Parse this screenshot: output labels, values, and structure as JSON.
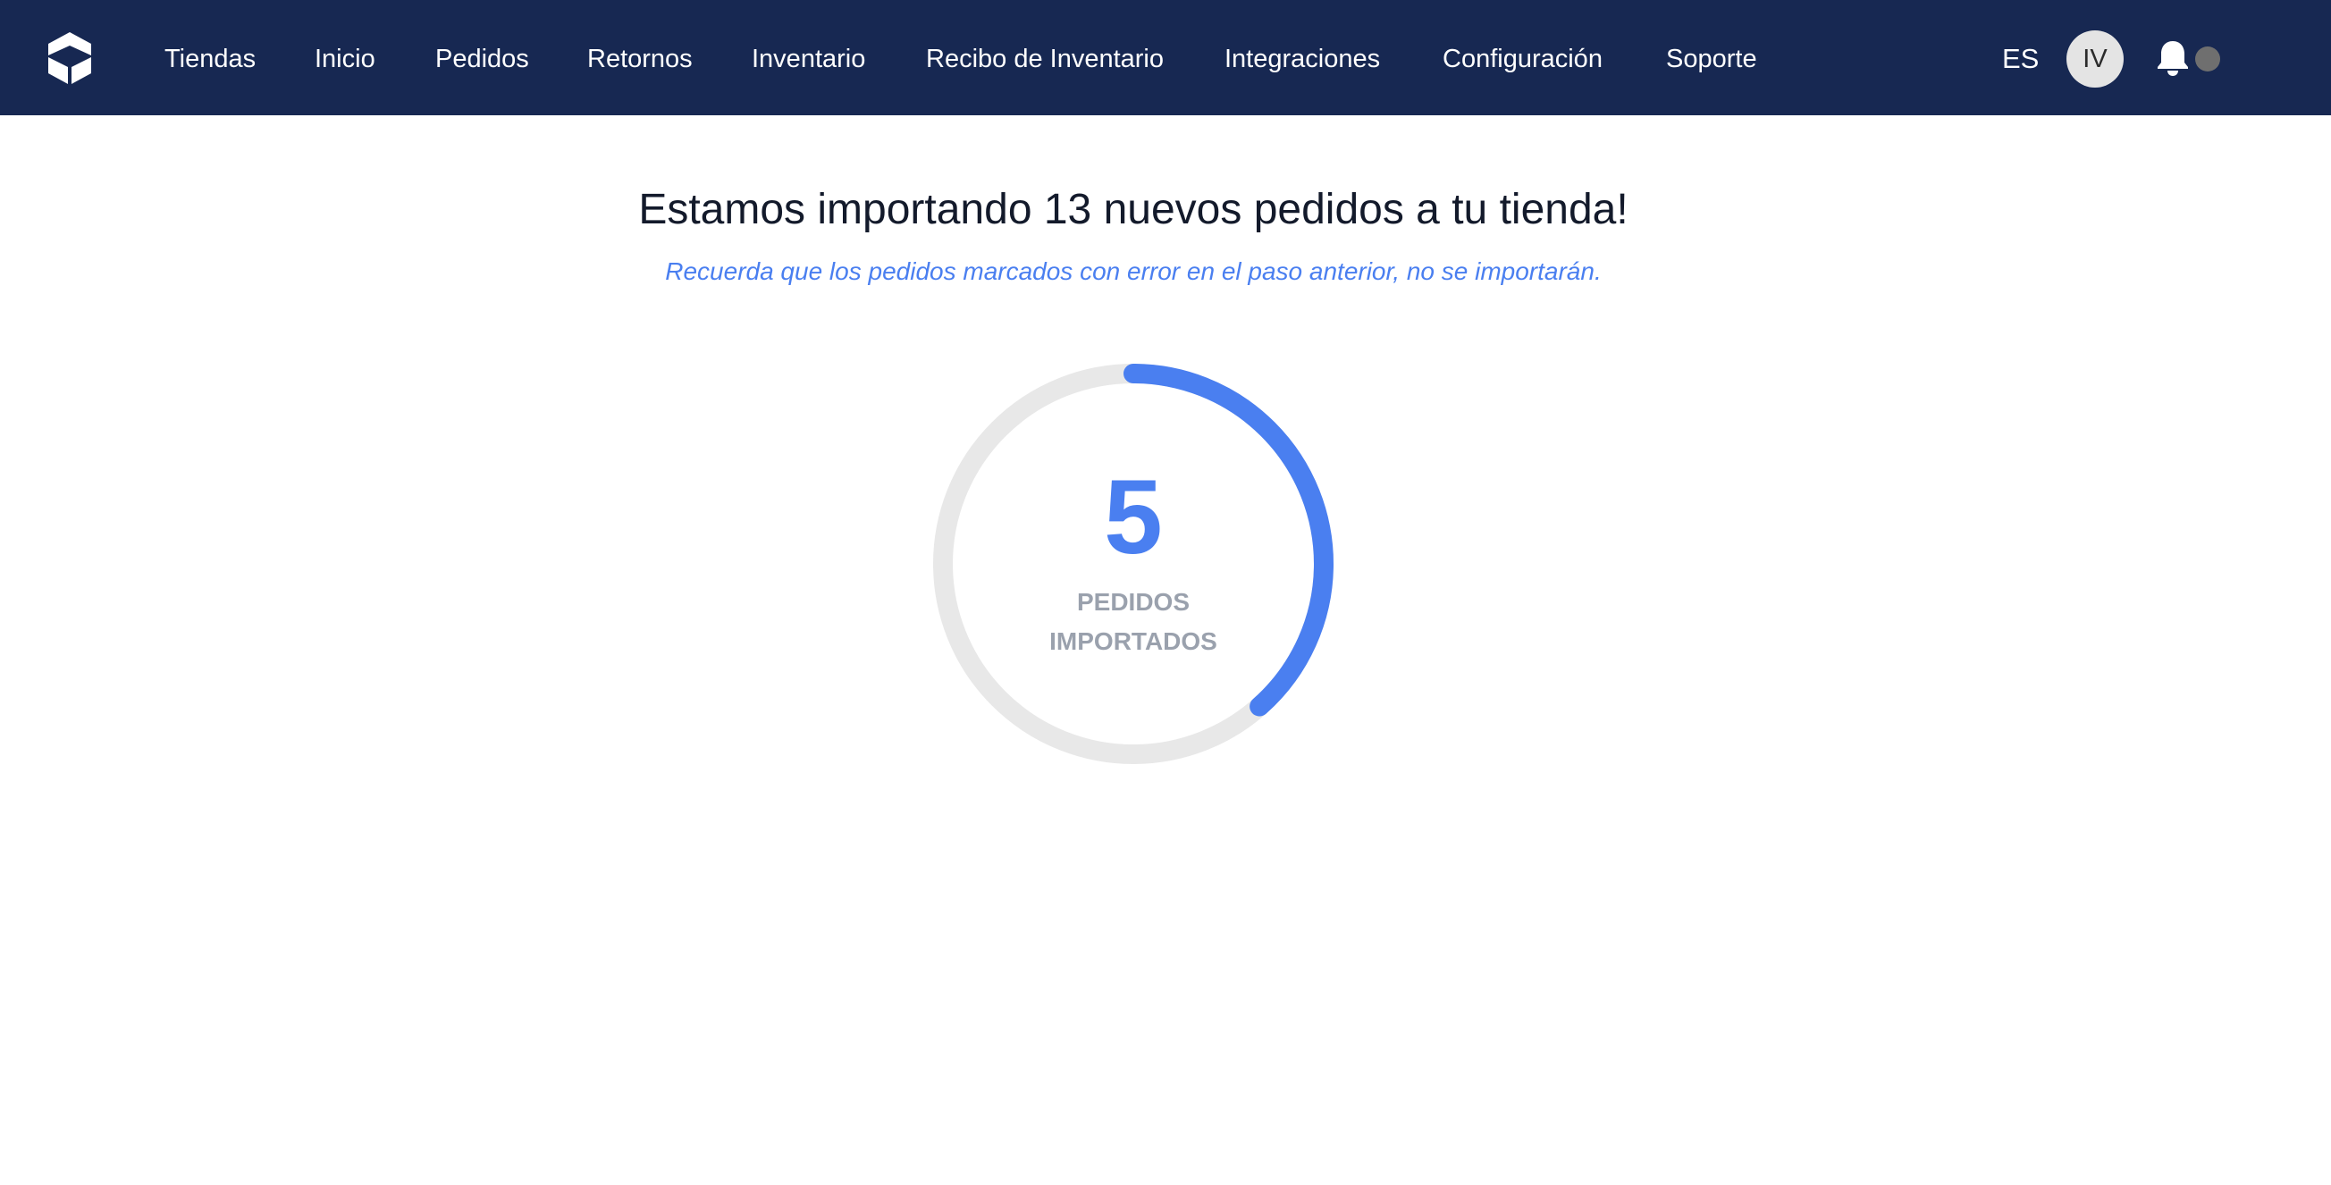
{
  "navbar": {
    "background": "#172852",
    "logo_icon": "cube-logo-icon",
    "items": [
      {
        "label": "Tiendas"
      },
      {
        "label": "Inicio"
      },
      {
        "label": "Pedidos"
      },
      {
        "label": "Retornos"
      },
      {
        "label": "Inventario"
      },
      {
        "label": "Recibo de Inventario"
      },
      {
        "label": "Integraciones"
      },
      {
        "label": "Configuración"
      },
      {
        "label": "Soporte"
      }
    ],
    "language": "ES",
    "avatar_initials": "IV",
    "notification_icon": "bell-icon"
  },
  "main": {
    "title": "Estamos importando 13 nuevos pedidos a tu tienda!",
    "subtitle": "Recuerda que los pedidos marcados con error en el paso anterior, no se importarán.",
    "progress": {
      "imported": "5",
      "total": 13,
      "label_line1": "PEDIDOS",
      "label_line2": "IMPORTADOS",
      "accent_color": "#4a7ff0",
      "track_color": "#e8e8e8"
    }
  }
}
